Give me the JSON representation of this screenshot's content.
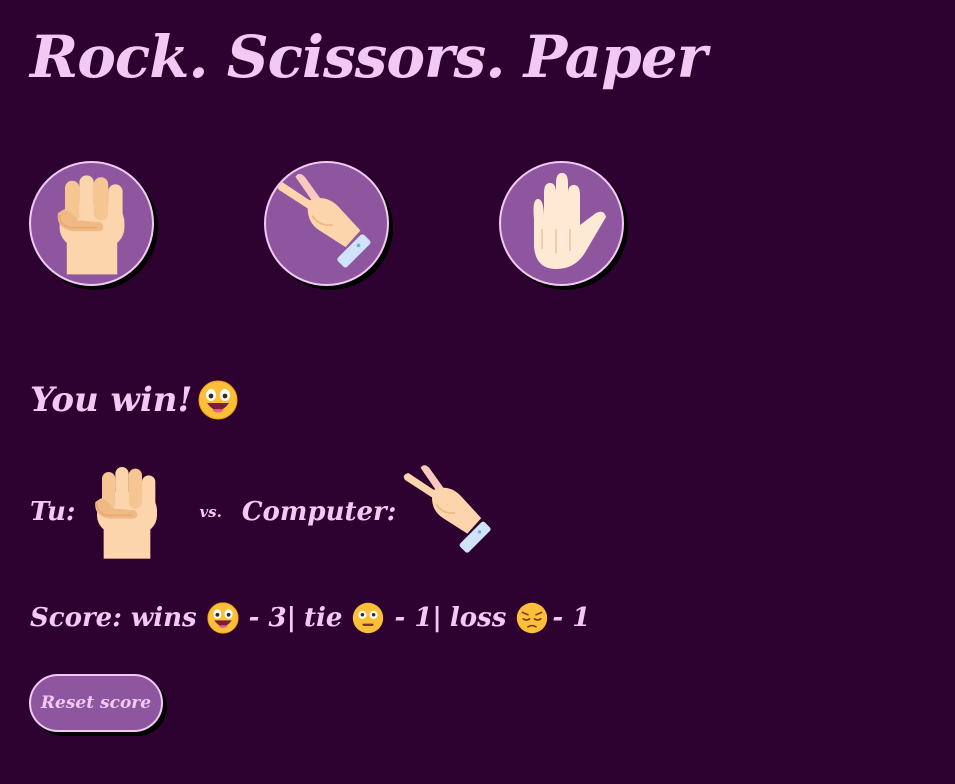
{
  "title": "Rock. Scissors. Paper",
  "choices": [
    {
      "icon": "rock-fist-icon"
    },
    {
      "icon": "scissors-hand-icon"
    },
    {
      "icon": "paper-hand-icon"
    }
  ],
  "result": {
    "text": "You win!",
    "icon": "grinning-face-icon"
  },
  "match": {
    "you_label": "Tu:",
    "you_icon": "rock-fist-icon",
    "vs_label": "vs.",
    "computer_label": "Computer:",
    "computer_icon": "scissors-hand-icon"
  },
  "score": {
    "prefix": "Score: wins",
    "wins": "- 3|",
    "tie_label": "tie",
    "ties": "- 1|",
    "loss_label": "loss",
    "losses": "- 1",
    "wins_icon": "grinning-face-icon",
    "tie_icon": "neutral-face-icon",
    "loss_icon": "pensive-face-icon"
  },
  "reset_label": "Reset score",
  "colors": {
    "background": "#2e0230",
    "accent": "#8f56a0",
    "text": "#f2c9f3",
    "skin": "#fcd5ad"
  }
}
